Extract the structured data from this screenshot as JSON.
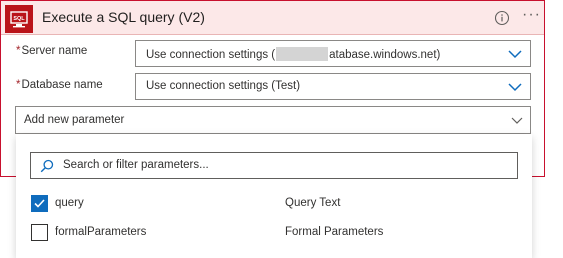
{
  "action": {
    "title": "Execute a SQL query (V2)",
    "accent_color": "#ba141a",
    "logo_text": "SQL",
    "logo_icon": "sql-server-icon",
    "info_icon": "info-icon",
    "more_label": "···"
  },
  "fields": [
    {
      "required_mark": "*",
      "label": "Server name",
      "value_prefix": "Use connection settings (",
      "value_suffix": "atabase.windows.net)"
    },
    {
      "required_mark": "*",
      "label": "Database name",
      "value": "Use connection settings (Test)"
    }
  ],
  "add_parameter": {
    "label": "Add new parameter"
  },
  "search": {
    "placeholder": "Search or filter parameters..."
  },
  "parameters": [
    {
      "name": "query",
      "description": "Query Text",
      "checked": true
    },
    {
      "name": "formalParameters",
      "description": "Formal Parameters",
      "checked": false
    }
  ]
}
